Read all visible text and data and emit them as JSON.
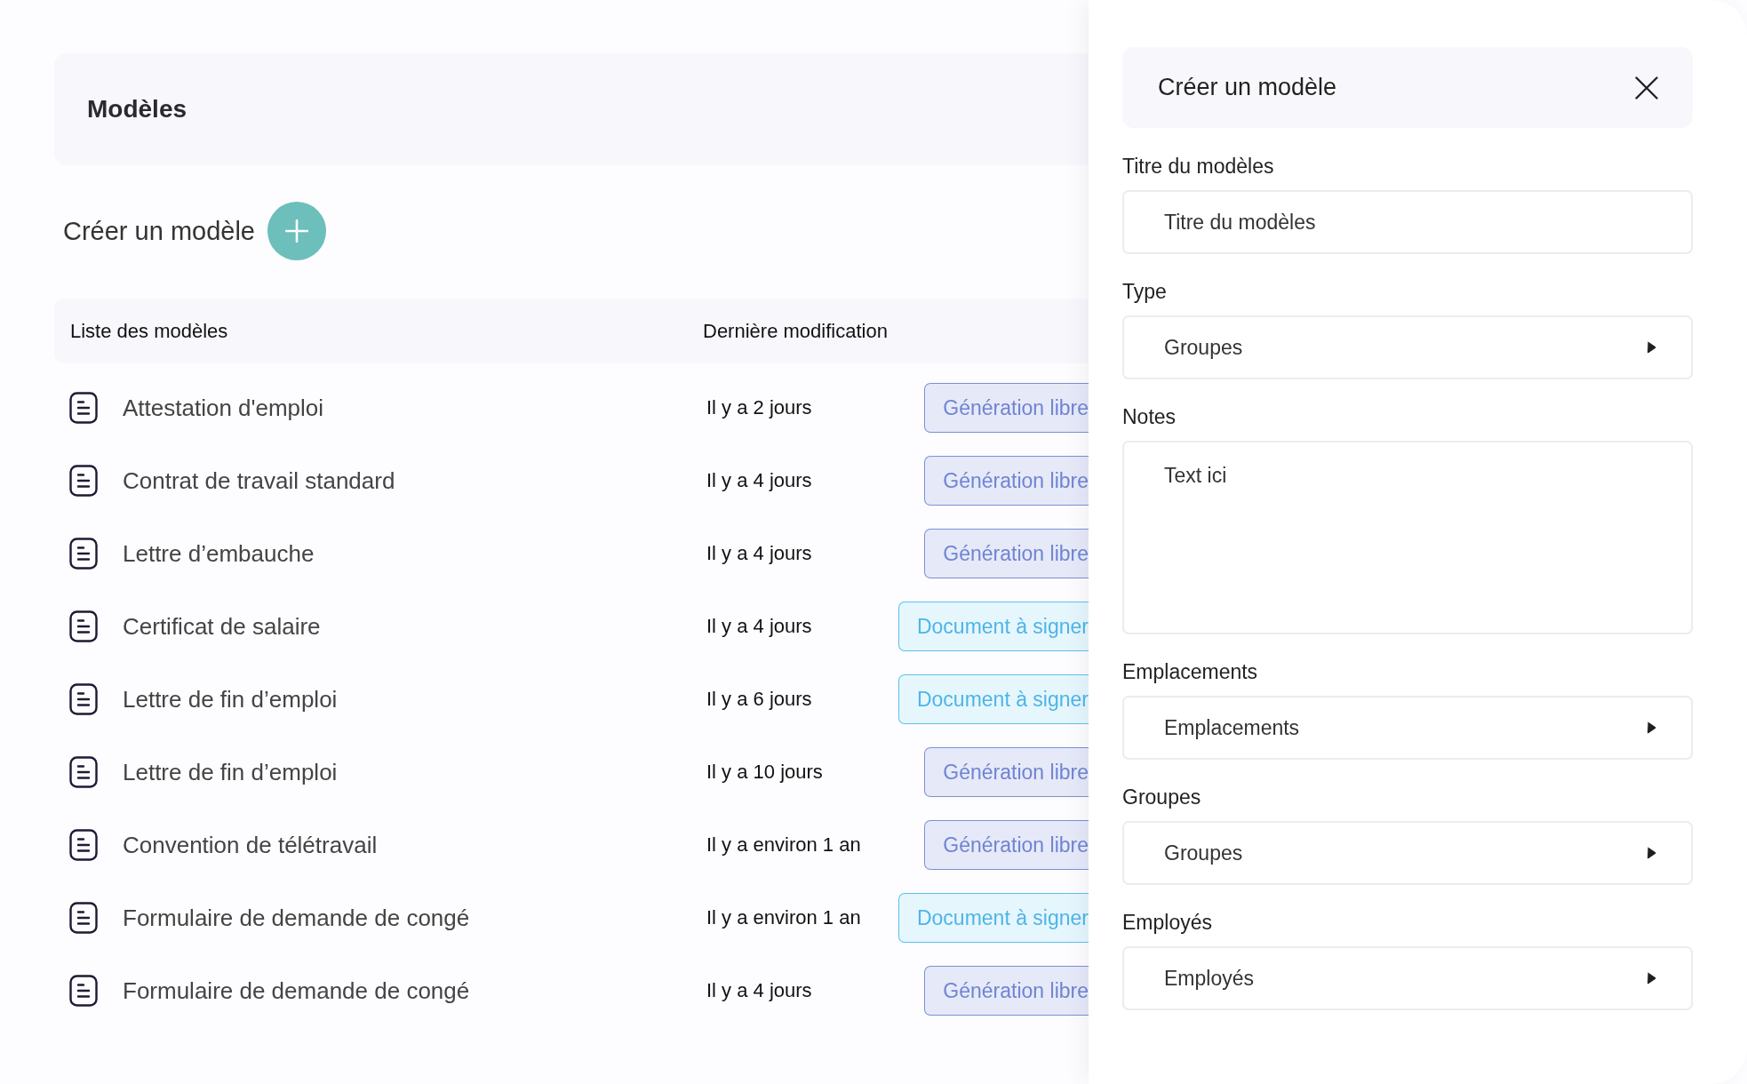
{
  "page_header": {
    "title": "Modèles"
  },
  "create_action": {
    "label": "Créer un modèle"
  },
  "table": {
    "columns": [
      "Liste des modèles",
      "Dernière modification"
    ],
    "rows": [
      {
        "name": "Attestation d'emploi",
        "modified": "Il y a 2 jours",
        "badge": {
          "label": "Génération libre",
          "kind": "free"
        }
      },
      {
        "name": "Contrat de travail standard",
        "modified": "Il y a 4 jours",
        "badge": {
          "label": "Génération libre",
          "kind": "free"
        }
      },
      {
        "name": "Lettre d’embauche",
        "modified": "Il y a 4 jours",
        "badge": {
          "label": "Génération libre",
          "kind": "free"
        }
      },
      {
        "name": "Certificat de salaire",
        "modified": "Il y a 4 jours",
        "badge": {
          "label": "Document à signer",
          "kind": "sign"
        }
      },
      {
        "name": "Lettre de fin d’emploi",
        "modified": "Il y a 6 jours",
        "badge": {
          "label": "Document à signer",
          "kind": "sign"
        }
      },
      {
        "name": "Lettre de fin d’emploi",
        "modified": "Il y a 10 jours",
        "badge": {
          "label": "Génération libre",
          "kind": "free"
        }
      },
      {
        "name": "Convention de télétravail",
        "modified": "Il y a environ 1 an",
        "badge": {
          "label": "Génération libre",
          "kind": "free"
        }
      },
      {
        "name": "Formulaire de demande de congé",
        "modified": "Il y a environ 1 an",
        "badge": {
          "label": "Document à signer",
          "kind": "sign"
        }
      },
      {
        "name": "Formulaire de demande de congé",
        "modified": "Il y a 4 jours",
        "badge": {
          "label": "Génération libre",
          "kind": "free"
        }
      }
    ]
  },
  "panel": {
    "title": "Créer un modèle",
    "fields": [
      {
        "label": "Titre du modèles",
        "kind": "text",
        "placeholder": "Titre du modèles"
      },
      {
        "label": "Type",
        "kind": "select",
        "placeholder": "Groupes"
      },
      {
        "label": "Notes",
        "kind": "textarea",
        "placeholder": "Text ici"
      },
      {
        "label": "Emplacements",
        "kind": "select",
        "placeholder": "Emplacements"
      },
      {
        "label": "Groupes",
        "kind": "select",
        "placeholder": "Groupes"
      },
      {
        "label": "Employés",
        "kind": "select",
        "placeholder": "Employés"
      }
    ]
  }
}
